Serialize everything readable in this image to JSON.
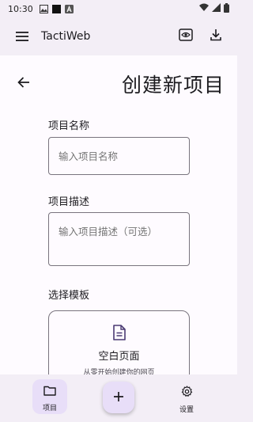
{
  "status_bar": {
    "time": "10:30",
    "icons": [
      "gallery-icon",
      "square-icon",
      "a-icon"
    ],
    "right_icons": [
      "wifi-icon",
      "signal-icon",
      "battery-icon"
    ]
  },
  "app_bar": {
    "title": "TactiWeb",
    "menu_icon": "menu-icon",
    "actions": [
      "preview-icon",
      "download-icon"
    ]
  },
  "page": {
    "title": "创建新项目",
    "back_icon": "arrow-back-icon"
  },
  "form": {
    "name_label": "项目名称",
    "name_placeholder": "输入项目名称",
    "description_label": "项目描述",
    "description_placeholder": "输入项目描述（可选）",
    "template_label": "选择模板"
  },
  "template_card": {
    "icon": "document-icon",
    "title": "空白页面",
    "description": "从零开始创建你的网页"
  },
  "bottom_nav": {
    "items": [
      {
        "label": "项目",
        "icon": "folder-icon",
        "selected": true
      },
      {
        "label": "设置",
        "icon": "gear-icon",
        "selected": false
      }
    ],
    "fab_icon": "plus-icon"
  },
  "colors": {
    "surface": "#fefbff",
    "background": "#f3eef6",
    "accent_container": "#e8def8",
    "outline": "#79747e",
    "icon_accent": "#4a3a73"
  }
}
